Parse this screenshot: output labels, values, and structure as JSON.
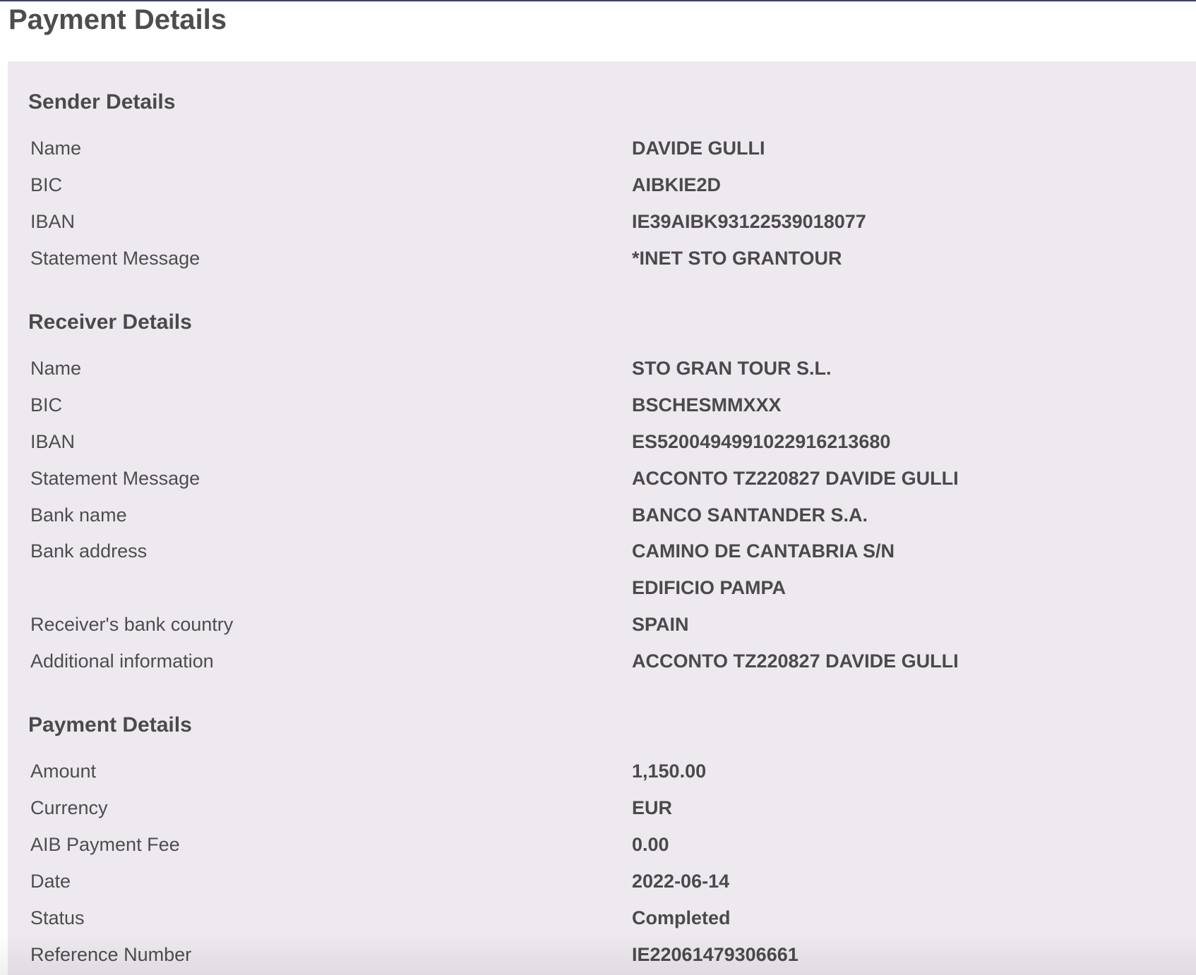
{
  "page_title": "Payment Details",
  "sender": {
    "heading": "Sender Details",
    "rows": [
      {
        "label": "Name",
        "value": "DAVIDE GULLI"
      },
      {
        "label": "BIC",
        "value": "AIBKIE2D"
      },
      {
        "label": "IBAN",
        "value": "IE39AIBK93122539018077"
      },
      {
        "label": "Statement Message",
        "value": "*INET STO GRANTOUR"
      }
    ]
  },
  "receiver": {
    "heading": "Receiver Details",
    "rows": [
      {
        "label": "Name",
        "value": "STO GRAN TOUR S.L."
      },
      {
        "label": "BIC",
        "value": "BSCHESMMXXX"
      },
      {
        "label": "IBAN",
        "value": "ES5200494991022916213680"
      },
      {
        "label": "Statement Message",
        "value": "ACCONTO TZ220827 DAVIDE GULLI"
      },
      {
        "label": "Bank name",
        "value": "BANCO SANTANDER S.A."
      },
      {
        "label": "Bank address",
        "value": "CAMINO DE CANTABRIA S/N"
      },
      {
        "label": "",
        "value": "EDIFICIO PAMPA"
      },
      {
        "label": "Receiver's bank country",
        "value": "SPAIN"
      },
      {
        "label": "Additional information",
        "value": "ACCONTO TZ220827 DAVIDE GULLI"
      }
    ]
  },
  "payment": {
    "heading": "Payment Details",
    "rows": [
      {
        "label": "Amount",
        "value": "1,150.00"
      },
      {
        "label": "Currency",
        "value": "EUR"
      },
      {
        "label": "AIB Payment Fee",
        "value": "0.00"
      },
      {
        "label": "Date",
        "value": "2022-06-14"
      },
      {
        "label": "Status",
        "value": "Completed"
      },
      {
        "label": "Reference Number",
        "value": "IE22061479306661"
      }
    ]
  }
}
